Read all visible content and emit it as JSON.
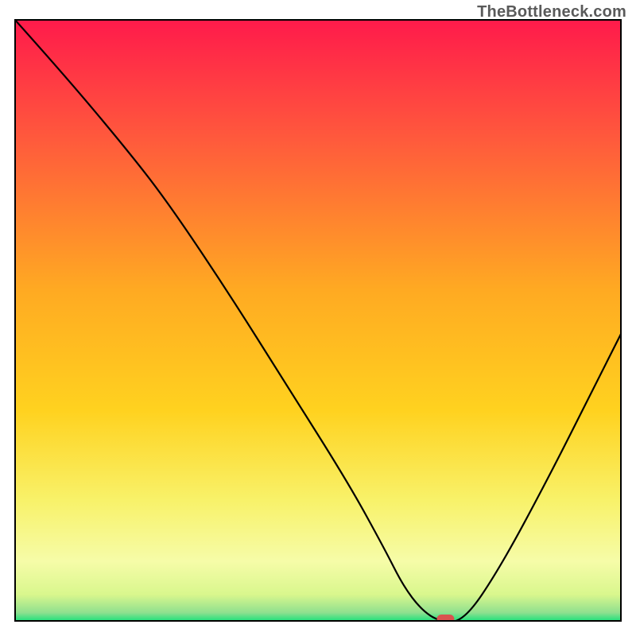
{
  "watermark": "TheBottleneck.com",
  "chart_data": {
    "type": "line",
    "title": "",
    "xlabel": "",
    "ylabel": "",
    "xlim": [
      0,
      100
    ],
    "ylim": [
      0,
      100
    ],
    "grid": false,
    "legend": false,
    "series": [
      {
        "name": "curve",
        "x": [
          0,
          8,
          18,
          25,
          35,
          45,
          55,
          61,
          64,
          67,
          70,
          74,
          80,
          88,
          95,
          100
        ],
        "y": [
          100,
          91,
          79,
          70,
          55,
          39,
          23,
          12,
          6,
          2,
          0,
          0,
          9,
          24,
          38,
          48
        ]
      }
    ],
    "marker": {
      "x": 71,
      "y": 0,
      "color": "#d9534f"
    },
    "gradient_stops": [
      {
        "offset": 0.0,
        "color": "#ff1a4b"
      },
      {
        "offset": 0.2,
        "color": "#ff5a3c"
      },
      {
        "offset": 0.45,
        "color": "#ffaa22"
      },
      {
        "offset": 0.65,
        "color": "#ffd21f"
      },
      {
        "offset": 0.8,
        "color": "#f8f26a"
      },
      {
        "offset": 0.9,
        "color": "#f6fca8"
      },
      {
        "offset": 0.955,
        "color": "#d9f78d"
      },
      {
        "offset": 0.985,
        "color": "#8fe08f"
      },
      {
        "offset": 1.0,
        "color": "#14e07a"
      }
    ],
    "frame_color": "#000000",
    "curve_color": "#000000",
    "curve_width": 2.2
  }
}
